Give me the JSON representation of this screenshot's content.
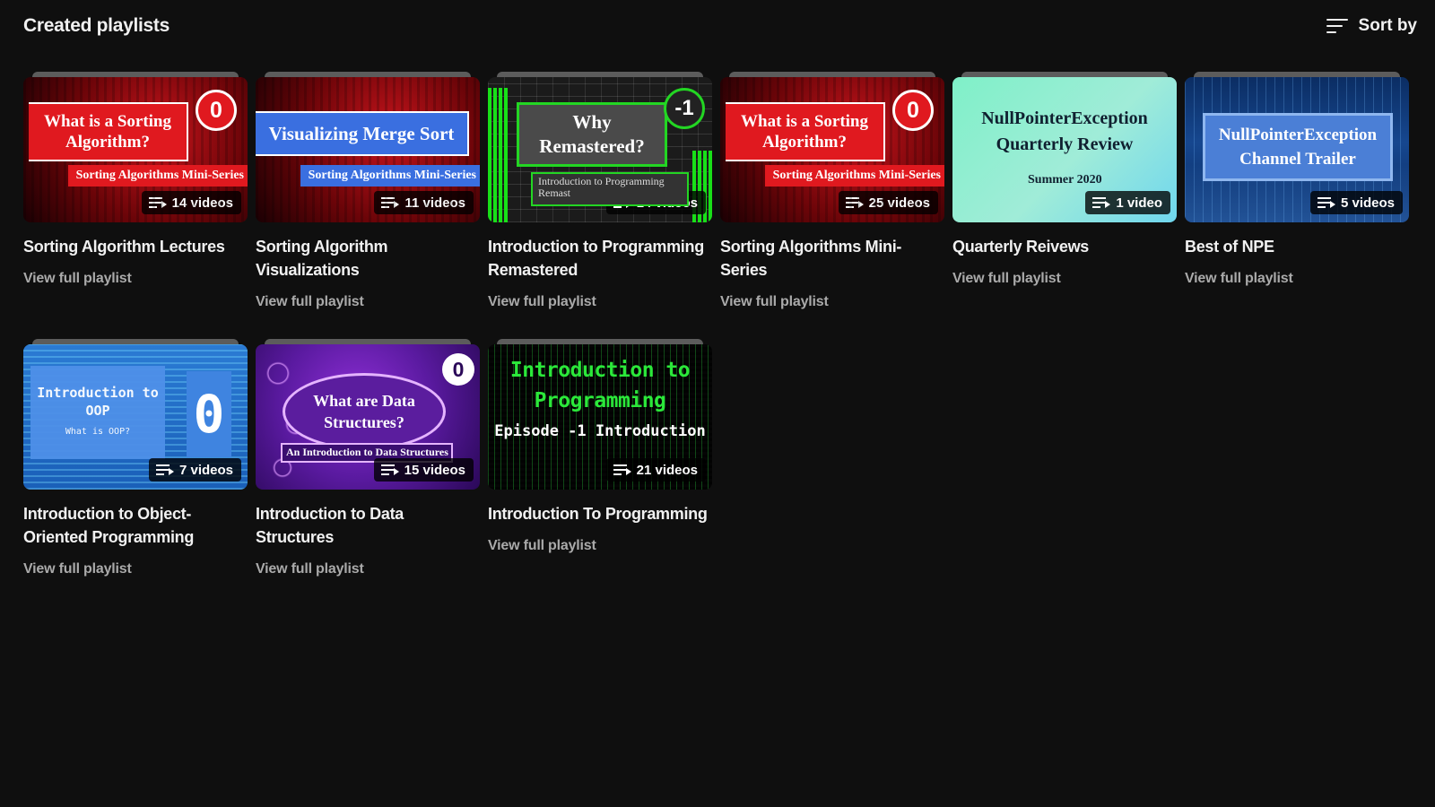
{
  "header": {
    "title": "Created playlists",
    "sort_label": "Sort by"
  },
  "view_label": "View full playlist",
  "playlists": [
    {
      "title": "Sorting Algorithm Lectures",
      "count": "14 videos",
      "thumb": {
        "headline": "What is a Sorting Algorithm?",
        "badge": "0",
        "strip": "Sorting Algorithms Mini-Series"
      }
    },
    {
      "title": "Sorting Algorithm Visualizations",
      "count": "11 videos",
      "thumb": {
        "headline": "Visualizing Merge Sort",
        "strip": "Sorting Algorithms Mini-Series"
      }
    },
    {
      "title": "Introduction to Programming Remastered",
      "count": "14 videos",
      "thumb": {
        "headline": "Why Remastered?",
        "badge": "-1",
        "strip": "Introduction to Programming Remast"
      }
    },
    {
      "title": "Sorting Algorithms Mini-Series",
      "count": "25 videos",
      "thumb": {
        "headline": "What is a Sorting Algorithm?",
        "badge": "0",
        "strip": "Sorting Algorithms Mini-Series"
      }
    },
    {
      "title": "Quarterly Reivews",
      "count": "1 video",
      "thumb": {
        "headline": "NullPointerException Quarterly Review",
        "strip": "Summer 2020"
      }
    },
    {
      "title": "Best of NPE",
      "count": "5 videos",
      "thumb": {
        "headline": "NullPointerException Channel Trailer"
      }
    },
    {
      "title": "Introduction to Object-Oriented Programming",
      "count": "7 videos",
      "thumb": {
        "headline": "Introduction to OOP",
        "subline": "What is OOP?",
        "badge": "0"
      }
    },
    {
      "title": "Introduction to Data Structures",
      "count": "15 videos",
      "thumb": {
        "headline": "What are Data Structures?",
        "badge": "0",
        "strip": "An Introduction to Data Structures"
      }
    },
    {
      "title": "Introduction To Programming",
      "count": "21 videos",
      "thumb": {
        "headline": "Introduction to Programming",
        "subline": "Episode -1 Introduction"
      }
    }
  ],
  "colors": {
    "background": "#0f0f0f",
    "text": "#f1f1f1",
    "secondary_text": "#aaaaaa"
  },
  "icons": {
    "sort": "sort-lines-icon",
    "playlist": "playlist-icon"
  }
}
